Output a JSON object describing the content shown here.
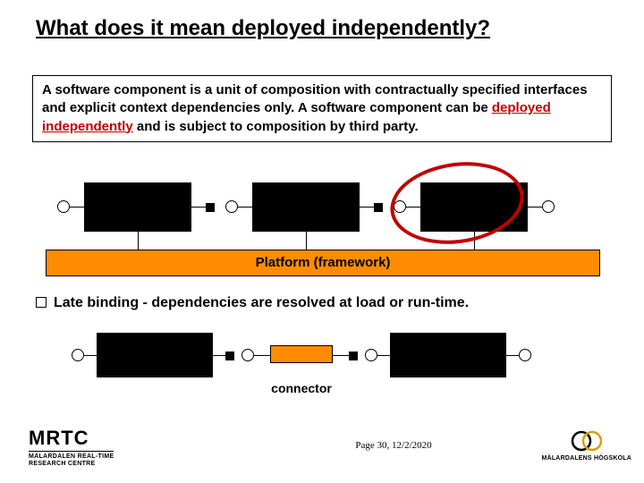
{
  "title": "What does it mean deployed independently?",
  "definition": {
    "pre": "A software component is a unit of composition with contractually specified interfaces and explicit context dependencies only. A software component can be ",
    "highlight": "deployed independently",
    "post": " and is subject to composition by third party."
  },
  "platform_label": "Platform (framework)",
  "bullet": "Late binding - dependencies are resolved at load or run-time.",
  "connector_label": "connector",
  "footer": "Page 30, 12/2/2020",
  "logo_left": {
    "main": "MRTC",
    "sub1": "MÄLARDALEN REAL-TIME",
    "sub2": "RESEARCH CENTRE"
  },
  "logo_right": "MÄLARDALENS HÖGSKOLA",
  "colors": {
    "accent": "#ff8c00",
    "highlight": "#c00000"
  }
}
